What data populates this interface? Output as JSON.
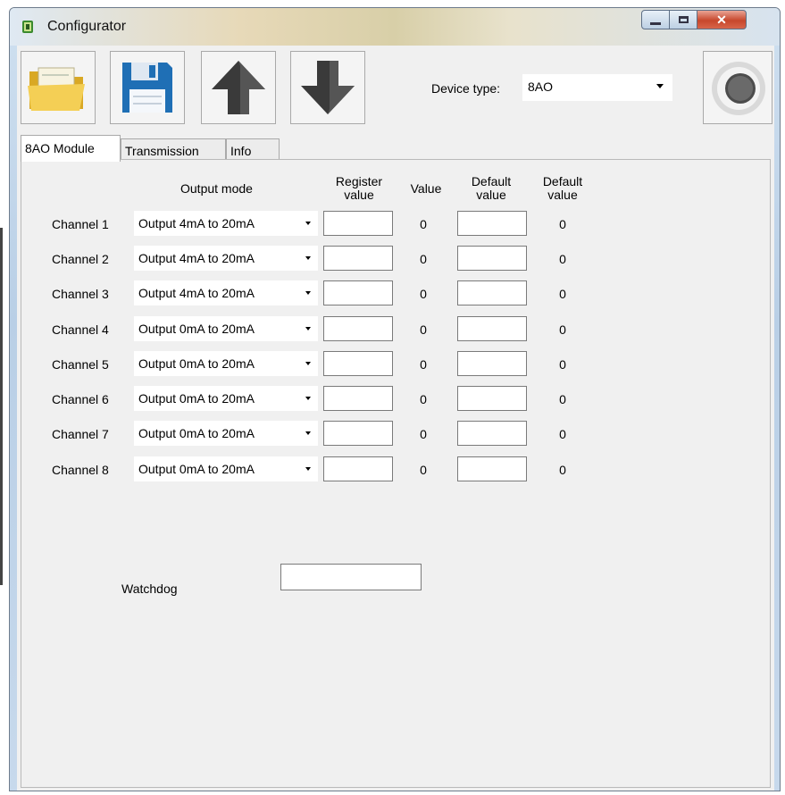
{
  "window": {
    "title": "Configurator"
  },
  "toolbar": {
    "open_icon": "folder-open-icon",
    "save_icon": "floppy-save-icon",
    "upload_icon": "arrow-up-icon",
    "download_icon": "arrow-down-icon",
    "device_type_label": "Device type:",
    "device_type_value": "8AO",
    "status_icon": "knob-icon"
  },
  "tabs": [
    {
      "label": "8AO Module",
      "active": true
    },
    {
      "label": "Transmission",
      "active": false
    },
    {
      "label": "Info",
      "active": false
    }
  ],
  "table": {
    "headers": {
      "output_mode": "Output mode",
      "register_value_line1": "Register",
      "register_value_line2": "value",
      "value": "Value",
      "default_value_line1": "Default",
      "default_value_line2": "value",
      "default_value2_line1": "Default",
      "default_value2_line2": "value"
    },
    "rows": [
      {
        "label": "Channel 1",
        "mode": "Output 4mA to 20mA",
        "register": "",
        "value": "0",
        "default": "",
        "default_val": "0"
      },
      {
        "label": "Channel 2",
        "mode": "Output 4mA to 20mA",
        "register": "",
        "value": "0",
        "default": "",
        "default_val": "0"
      },
      {
        "label": "Channel 3",
        "mode": "Output 4mA to 20mA",
        "register": "",
        "value": "0",
        "default": "",
        "default_val": "0"
      },
      {
        "label": "Channel 4",
        "mode": "Output 0mA to 20mA",
        "register": "",
        "value": "0",
        "default": "",
        "default_val": "0"
      },
      {
        "label": "Channel 5",
        "mode": "Output 0mA to 20mA",
        "register": "",
        "value": "0",
        "default": "",
        "default_val": "0"
      },
      {
        "label": "Channel 6",
        "mode": "Output 0mA to 20mA",
        "register": "",
        "value": "0",
        "default": "",
        "default_val": "0"
      },
      {
        "label": "Channel 7",
        "mode": "Output 0mA to 20mA",
        "register": "",
        "value": "0",
        "default": "",
        "default_val": "0"
      },
      {
        "label": "Channel 8",
        "mode": "Output 0mA to 20mA",
        "register": "",
        "value": "0",
        "default": "",
        "default_val": "0"
      }
    ]
  },
  "watchdog": {
    "label": "Watchdog",
    "value": ""
  },
  "colors": {
    "title_accent": "#e7d9b8",
    "close_button": "#c7472c",
    "folder": "#f2c94c",
    "save": "#1f6fb5",
    "arrow": "#3a3a3a"
  }
}
